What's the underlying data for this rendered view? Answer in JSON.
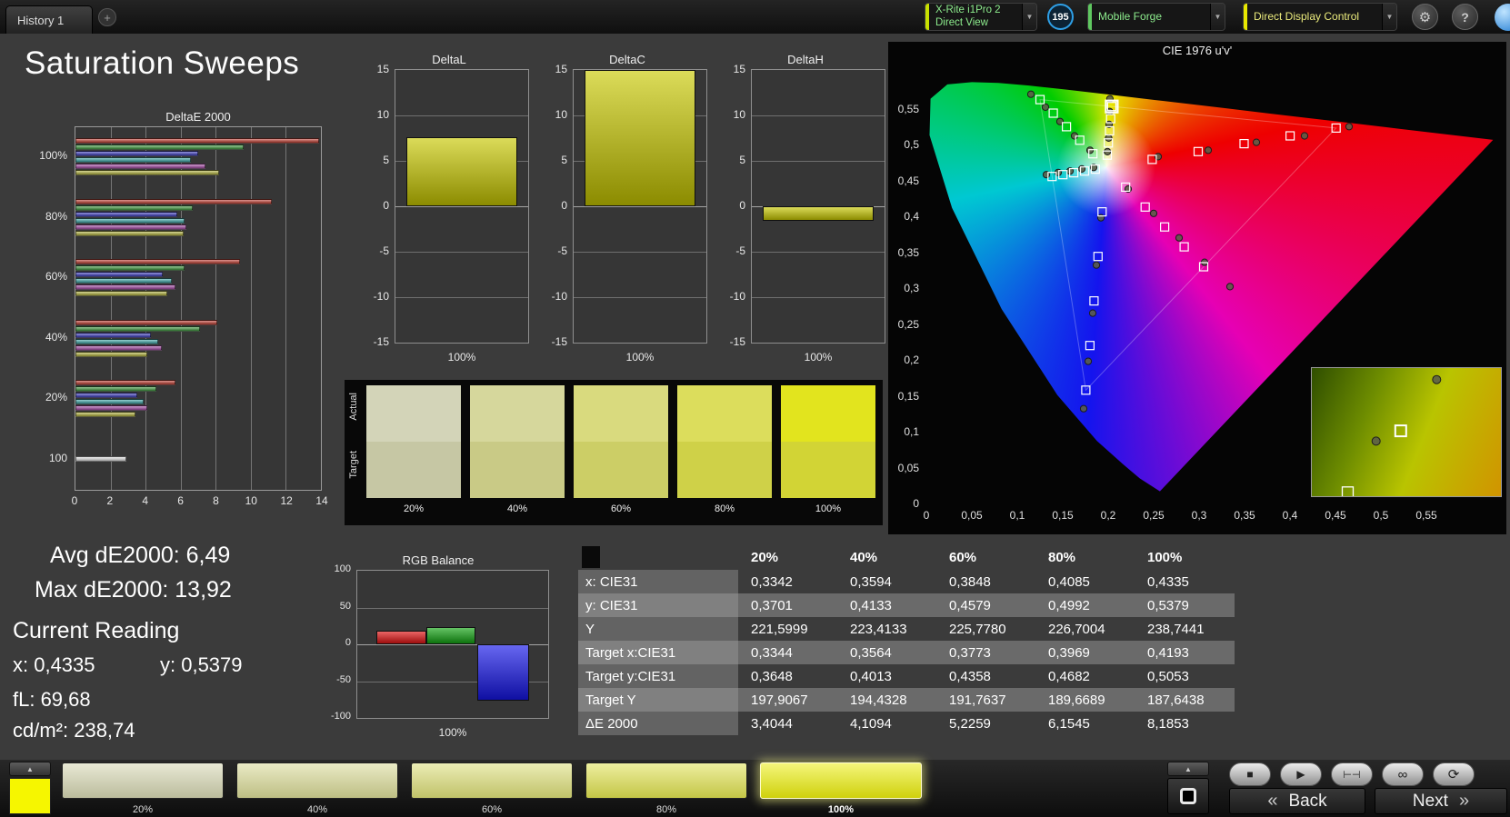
{
  "title": "Saturation Sweeps",
  "top_bar": {
    "history_tab": "History 1",
    "add_tab": "+",
    "meter_line1": "X-Rite i1Pro 2",
    "meter_line2": "Direct View",
    "badge": "195",
    "source": "Mobile Forge",
    "display_control": "Direct Display Control"
  },
  "icons": {
    "gear": "⚙",
    "help": "?",
    "up": "▲",
    "stop": "■",
    "play": "▶",
    "marker": "⊢⊣",
    "infinity": "∞",
    "refresh": "⟳"
  },
  "stats": {
    "avg": "Avg dE2000: 6,49",
    "max": "Max dE2000: 13,92"
  },
  "current_reading": {
    "heading": "Current Reading",
    "x": "x: 0,4335",
    "y": "y: 0,5379",
    "fl": "fL: 69,68",
    "cd": "cd/m²: 238,74"
  },
  "swatch_panel": {
    "row_labels": [
      "Actual",
      "Target"
    ],
    "levels": [
      "20%",
      "40%",
      "60%",
      "80%",
      "100%"
    ],
    "actual_colors": [
      "#d3d4b8",
      "#d6d79c",
      "#d9da7e",
      "#dcdd5c",
      "#e2e41e"
    ],
    "target_colors": [
      "#c6c7a4",
      "#c9ca86",
      "#ccce66",
      "#cfd148",
      "#d2d435"
    ]
  },
  "table": {
    "columns": [
      "20%",
      "40%",
      "60%",
      "80%",
      "100%"
    ],
    "rows": [
      {
        "label": "x: CIE31",
        "values": [
          "0,3342",
          "0,3594",
          "0,3848",
          "0,4085",
          "0,4335"
        ]
      },
      {
        "label": "y: CIE31",
        "values": [
          "0,3701",
          "0,4133",
          "0,4579",
          "0,4992",
          "0,5379"
        ]
      },
      {
        "label": "Y",
        "values": [
          "221,5999",
          "223,4133",
          "225,7780",
          "226,7004",
          "238,7441"
        ]
      },
      {
        "label": "Target x:CIE31",
        "values": [
          "0,3344",
          "0,3564",
          "0,3773",
          "0,3969",
          "0,4193"
        ]
      },
      {
        "label": "Target y:CIE31",
        "values": [
          "0,3648",
          "0,4013",
          "0,4358",
          "0,4682",
          "0,5053"
        ]
      },
      {
        "label": "Target Y",
        "values": [
          "197,9067",
          "194,4328",
          "191,7637",
          "189,6689",
          "187,6438"
        ]
      },
      {
        "label": "ΔE 2000",
        "values": [
          "3,4044",
          "4,1094",
          "5,2259",
          "6,1545",
          "8,1853"
        ]
      }
    ]
  },
  "bottom_bar": {
    "levels": [
      "20%",
      "40%",
      "60%",
      "80%",
      "100%"
    ],
    "swatch_colors": [
      "#d5d6b2",
      "#d8d996",
      "#dbdd78",
      "#dfe150",
      "#ecee0e"
    ],
    "selected_index": 4,
    "back": "Back",
    "next": "Next",
    "back_chevron": "«",
    "next_chevron": "»"
  },
  "chart_data": [
    {
      "id": "deltae_sweep",
      "type": "bar",
      "orientation": "horizontal",
      "title": "DeltaE 2000",
      "xlim": [
        0,
        14
      ],
      "xticks": [
        0,
        2,
        4,
        6,
        8,
        10,
        12,
        14
      ],
      "group_labels": [
        "100%",
        "80%",
        "60%",
        "40%",
        "20%",
        "100"
      ],
      "series": [
        {
          "name": "Red",
          "color": "#c03a2e",
          "values": [
            13.92,
            11.2,
            9.4,
            8.1,
            5.7,
            null
          ]
        },
        {
          "name": "Green",
          "color": "#3f9b3f",
          "values": [
            9.6,
            6.7,
            6.2,
            7.1,
            4.6,
            null
          ]
        },
        {
          "name": "Blue",
          "color": "#3a3ac0",
          "values": [
            7.0,
            5.8,
            5.0,
            4.3,
            3.5,
            null
          ]
        },
        {
          "name": "Cyan",
          "color": "#3aa8a8",
          "values": [
            6.6,
            6.2,
            5.5,
            4.7,
            3.9,
            null
          ]
        },
        {
          "name": "Magenta",
          "color": "#a84aa8",
          "values": [
            7.4,
            6.3,
            5.7,
            4.9,
            4.1,
            null
          ]
        },
        {
          "name": "Yellow",
          "color": "#b4b43a",
          "values": [
            8.19,
            6.15,
            5.23,
            4.11,
            3.4,
            null
          ]
        },
        {
          "name": "White",
          "color": "#e8e8e8",
          "values": [
            null,
            null,
            null,
            null,
            null,
            2.9
          ]
        }
      ]
    },
    {
      "id": "deltaL",
      "type": "bar",
      "title": "DeltaL",
      "ylim": [
        -15,
        15
      ],
      "yticks": [
        15,
        10,
        5,
        0,
        -5,
        -10,
        -15
      ],
      "categories": [
        "100%"
      ],
      "values": [
        7.6
      ],
      "bar_color": "#c8c800"
    },
    {
      "id": "deltaC",
      "type": "bar",
      "title": "DeltaC",
      "ylim": [
        -15,
        15
      ],
      "yticks": [
        15,
        10,
        5,
        0,
        -5,
        -10,
        -15
      ],
      "categories": [
        "100%"
      ],
      "values": [
        15
      ],
      "bar_color": "#c8c800"
    },
    {
      "id": "deltaH",
      "type": "bar",
      "title": "DeltaH",
      "ylim": [
        -15,
        15
      ],
      "yticks": [
        15,
        10,
        5,
        0,
        -5,
        -10,
        -15
      ],
      "categories": [
        "100%"
      ],
      "values": [
        -1.6
      ],
      "bar_color": "#c8c800"
    },
    {
      "id": "rgb_balance",
      "type": "bar",
      "title": "RGB Balance",
      "ylim": [
        -100,
        100
      ],
      "yticks": [
        100,
        50,
        0,
        -50,
        -100
      ],
      "categories": [
        "100%"
      ],
      "series": [
        {
          "name": "Red",
          "color": "#e01212",
          "value": 18
        },
        {
          "name": "Green",
          "color": "#12a312",
          "value": 24
        },
        {
          "name": "Blue",
          "color": "#1515e8",
          "value": -76
        }
      ]
    },
    {
      "id": "cie",
      "type": "scatter",
      "title": "CIE 1976 u'v'",
      "xlim": [
        0,
        0.6
      ],
      "ylim": [
        0,
        0.6
      ],
      "xticks": [
        "0",
        "0,05",
        "0,1",
        "0,15",
        "0,2",
        "0,25",
        "0,3",
        "0,35",
        "0,4",
        "0,45",
        "0,5",
        "0,55"
      ],
      "yticks": [
        "0,55",
        "0,5",
        "0,45",
        "0,4",
        "0,35",
        "0,3",
        "0,25",
        "0,2",
        "0,15",
        "0,1",
        "0,05",
        "0"
      ],
      "white_point": [
        0.1978,
        0.4683
      ],
      "gamut_triangle": [
        [
          0.4507,
          0.5229
        ],
        [
          0.125,
          0.5625
        ],
        [
          0.1754,
          0.1579
        ]
      ],
      "targets": [
        [
          0.2484,
          0.4792
        ],
        [
          0.299,
          0.4901
        ],
        [
          0.3495,
          0.5011
        ],
        [
          0.4001,
          0.512
        ],
        [
          0.4507,
          0.5229
        ],
        [
          0.1832,
          0.4871
        ],
        [
          0.1687,
          0.506
        ],
        [
          0.1541,
          0.5248
        ],
        [
          0.1396,
          0.5437
        ],
        [
          0.125,
          0.5625
        ],
        [
          0.1933,
          0.4062
        ],
        [
          0.1888,
          0.3441
        ],
        [
          0.1844,
          0.2821
        ],
        [
          0.1799,
          0.22
        ],
        [
          0.1754,
          0.1579
        ],
        [
          0.1859,
          0.4657
        ],
        [
          0.174,
          0.4631
        ],
        [
          0.1621,
          0.4606
        ],
        [
          0.1502,
          0.458
        ],
        [
          0.1383,
          0.4554
        ],
        [
          0.2192,
          0.4406
        ],
        [
          0.2407,
          0.4129
        ],
        [
          0.2621,
          0.3852
        ],
        [
          0.2836,
          0.3575
        ],
        [
          0.305,
          0.3298
        ],
        [
          0.199,
          0.4852
        ],
        [
          0.2002,
          0.5021
        ],
        [
          0.2015,
          0.519
        ],
        [
          0.2027,
          0.536
        ],
        [
          0.2039,
          0.5529
        ]
      ],
      "measurements": [
        [
          0.255,
          0.483
        ],
        [
          0.31,
          0.492
        ],
        [
          0.363,
          0.503
        ],
        [
          0.416,
          0.512
        ],
        [
          0.465,
          0.525
        ],
        [
          0.18,
          0.492
        ],
        [
          0.163,
          0.512
        ],
        [
          0.147,
          0.532
        ],
        [
          0.131,
          0.552
        ],
        [
          0.115,
          0.57
        ],
        [
          0.192,
          0.398
        ],
        [
          0.187,
          0.332
        ],
        [
          0.183,
          0.265
        ],
        [
          0.178,
          0.198
        ],
        [
          0.173,
          0.132
        ],
        [
          0.184,
          0.468
        ],
        [
          0.171,
          0.466
        ],
        [
          0.158,
          0.463
        ],
        [
          0.145,
          0.461
        ],
        [
          0.132,
          0.458
        ],
        [
          0.222,
          0.438
        ],
        [
          0.25,
          0.404
        ],
        [
          0.278,
          0.37
        ],
        [
          0.306,
          0.336
        ],
        [
          0.334,
          0.302
        ],
        [
          0.1992,
          0.49
        ],
        [
          0.2005,
          0.509
        ],
        [
          0.201,
          0.528
        ],
        [
          0.2015,
          0.546
        ],
        [
          0.2019,
          0.5637
        ]
      ],
      "highlight": [
        0.2039,
        0.5529
      ],
      "inset": {
        "squares": [
          [
            0.47,
            0.49
          ],
          [
            0.19,
            0.97
          ]
        ],
        "circles": [
          [
            0.66,
            0.09
          ],
          [
            0.34,
            0.57
          ]
        ]
      }
    }
  ]
}
